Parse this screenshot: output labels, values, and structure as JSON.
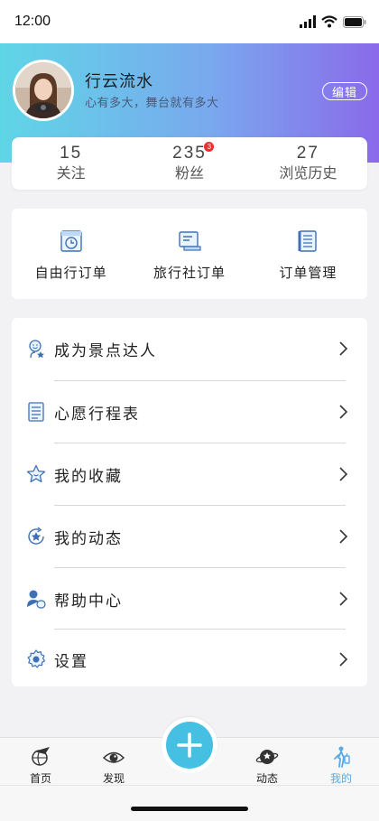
{
  "status_bar": {
    "time": "12:00"
  },
  "profile": {
    "name": "行云流水",
    "motto": "心有多大，舞台就有多大",
    "edit_label": "编辑"
  },
  "stats": [
    {
      "value": "15",
      "label": "关注"
    },
    {
      "value": "235",
      "label": "粉丝",
      "badge": "3"
    },
    {
      "value": "27",
      "label": "浏览历史"
    }
  ],
  "orders": [
    {
      "label": "自由行订单",
      "icon": "calendar-clock-icon"
    },
    {
      "label": "旅行社订单",
      "icon": "monitor-icon"
    },
    {
      "label": "订单管理",
      "icon": "notebook-icon"
    }
  ],
  "menu": [
    {
      "label": "成为景点达人",
      "icon": "expert-person-icon"
    },
    {
      "label": "心愿行程表",
      "icon": "list-icon"
    },
    {
      "label": "我的收藏",
      "icon": "star-icon"
    },
    {
      "label": "我的动态",
      "icon": "refresh-star-icon"
    },
    {
      "label": "帮助中心",
      "icon": "help-user-icon"
    },
    {
      "label": "设置",
      "icon": "gear-icon"
    }
  ],
  "tabbar": {
    "items": [
      {
        "label": "首页",
        "icon": "plane-globe-icon"
      },
      {
        "label": "发现",
        "icon": "eye-icon"
      },
      {
        "label": "动态",
        "icon": "planet-star-icon"
      },
      {
        "label": "我的",
        "icon": "traveler-icon",
        "active": true
      }
    ],
    "fab_icon": "plus-icon"
  },
  "colors": {
    "header_gradient": [
      "#5fd6e6",
      "#79a9ee",
      "#8a6aea"
    ],
    "fab": "#46c0e2",
    "active_tab": "#5aa8e6",
    "badge": "#e8302c"
  }
}
